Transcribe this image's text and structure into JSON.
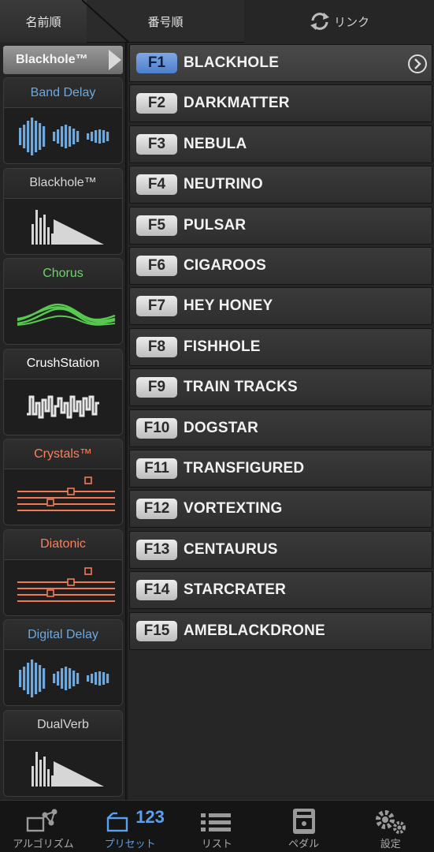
{
  "tabs": {
    "by_name": "名前順",
    "by_number": "番号順",
    "link": "リンク"
  },
  "left_header": "Blackhole™",
  "algorithms": [
    {
      "label": "Band Delay",
      "color": "#6fa8dc",
      "icon": "delay-bars-icon"
    },
    {
      "label": "Blackhole™",
      "color": "#d6d6d6",
      "icon": "reverb-decay-icon"
    },
    {
      "label": "Chorus",
      "color": "#6fd36a",
      "icon": "chorus-wave-icon"
    },
    {
      "label": "CrushStation",
      "color": "#ffffff",
      "icon": "crush-wave-icon"
    },
    {
      "label": "Crystals™",
      "color": "#ff7f5a",
      "icon": "pitch-staff-icon"
    },
    {
      "label": "Diatonic",
      "color": "#ff7f5a",
      "icon": "pitch-staff-icon"
    },
    {
      "label": "Digital Delay",
      "color": "#6fa8dc",
      "icon": "delay-bars-icon"
    },
    {
      "label": "DualVerb",
      "color": "#d6d6d6",
      "icon": "reverb-decay-icon"
    }
  ],
  "presets": [
    {
      "num": "F1",
      "name": "BLACKHOLE"
    },
    {
      "num": "F2",
      "name": "DARKMATTER"
    },
    {
      "num": "F3",
      "name": "NEBULA"
    },
    {
      "num": "F4",
      "name": "NEUTRINO"
    },
    {
      "num": "F5",
      "name": "PULSAR"
    },
    {
      "num": "F6",
      "name": "CIGAROOS"
    },
    {
      "num": "F7",
      "name": "HEY HONEY"
    },
    {
      "num": "F8",
      "name": "FISHHOLE"
    },
    {
      "num": "F9",
      "name": "TRAIN TRACKS"
    },
    {
      "num": "F10",
      "name": "DOGSTAR"
    },
    {
      "num": "F11",
      "name": "TRANSFIGURED"
    },
    {
      "num": "F12",
      "name": "VORTEXTING"
    },
    {
      "num": "F13",
      "name": "CENTAURUS"
    },
    {
      "num": "F14",
      "name": "STARCRATER"
    },
    {
      "num": "F15",
      "name": "AMEBLACKDRONE"
    }
  ],
  "selected_preset": "F1",
  "bottom_nav": [
    {
      "label": "アルゴリズム",
      "icon": "algorithm-icon"
    },
    {
      "label": "プリセット",
      "icon": "preset-icon",
      "badge": "123"
    },
    {
      "label": "リスト",
      "icon": "list-icon"
    },
    {
      "label": "ペダル",
      "icon": "pedal-icon"
    },
    {
      "label": "設定",
      "icon": "gear-icon"
    }
  ],
  "active_nav": "プリセット"
}
